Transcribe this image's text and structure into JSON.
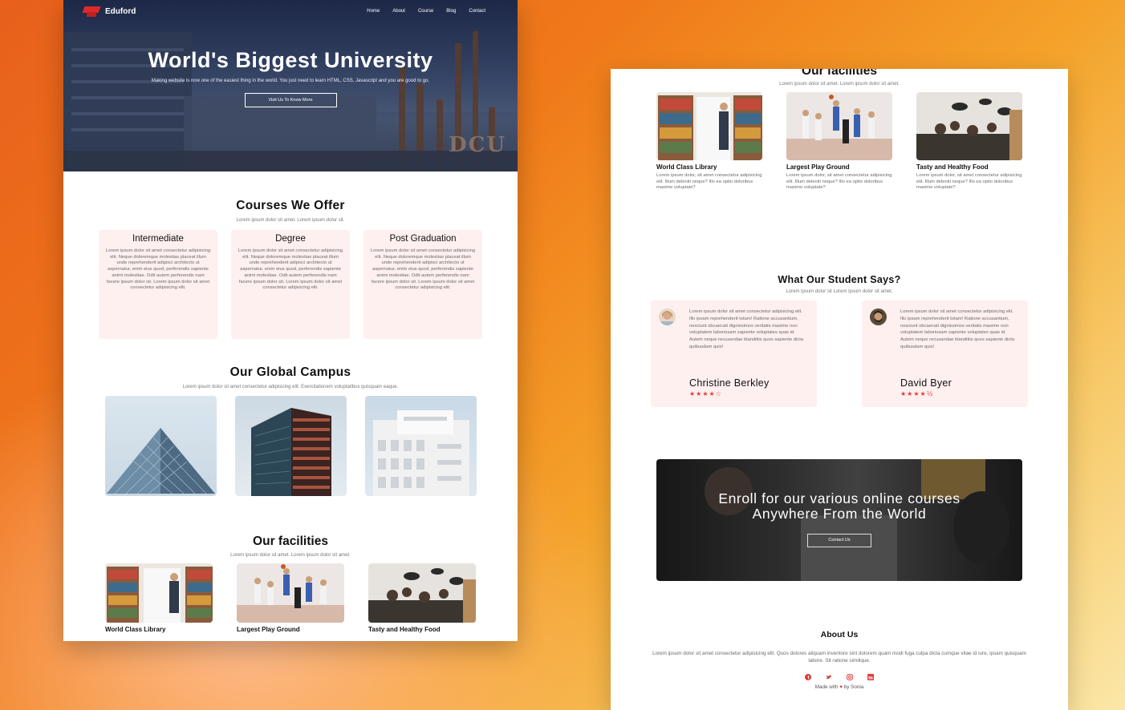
{
  "brand": {
    "name": "Eduford",
    "accent": "#e23b3b",
    "card_bg": "#fdf0ef"
  },
  "nav": {
    "items": [
      "Home",
      "About",
      "Course",
      "Blog",
      "Contact"
    ]
  },
  "hero": {
    "title": "World's Biggest University",
    "subtitle": "Making website is now one of the easiest thing in the world. You just need to learn HTML, CSS, Javascript and you are good to go.",
    "button": "Visit Us To Know More",
    "watermark": "DCU"
  },
  "courses": {
    "title": "Courses We Offer",
    "subtitle": "Lorem ipsum dolor sit amet. Lorem ipsum dolor sit.",
    "items": [
      {
        "name": "Intermediate",
        "text": "Lorem ipsum dolor sit amet consectetur adipisicing elit. Neque doloremque molestias placeat illum unde reprehenderit adipisci architecto ut aspernatur, enim eius quod, perferendis sapiente animi molestiae. Odit autem perferendis nam facere ipsum dolor sit. Lorem ipsum dolor sit amet consectetur adipisicing elit."
      },
      {
        "name": "Degree",
        "text": "Lorem ipsum dolor sit amet consectetur adipisicing elit. Neque doloremque molestias placeat illum unde reprehenderit adipisci architecto ut aspernatur, enim eius quod, perferendis sapiente animi molestiae. Odit autem perferendis nam facere ipsum dolor sit. Lorem ipsum dolor sit amet consectetur adipisicing elit."
      },
      {
        "name": "Post Graduation",
        "text": "Lorem ipsum dolor sit amet consectetur adipisicing elit. Neque doloremque molestias placeat illum unde reprehenderit adipisci architecto ut aspernatur, enim eius quod, perferendis sapiente animi molestiae. Odit autem perferendis nam facere ipsum dolor sit. Lorem ipsum dolor sit amet consectetur adipisicing elit."
      }
    ]
  },
  "campus": {
    "title": "Our Global Campus",
    "subtitle": "Lorem ipsum dolor sit amet consectetur adipisicing elit. Exercitationem voluptatibus quisquam eaque."
  },
  "facilities": {
    "title": "Our facilities",
    "subtitle": "Lorem ipsum dolor sit amet. Lorem ipsum dolor sit amet.",
    "items": [
      {
        "name": "World Class Library",
        "text": "Lorem ipsum dolor, sit amet consectetur adipisicing elit. Illum deleniti neque? Illo ea optio doloribus maxime voluptate?"
      },
      {
        "name": "Largest Play Ground",
        "text": "Lorem ipsum dolor, sit amet consectetur adipisicing elit. Illum deleniti neque? Illo ea optio doloribus maxime voluptate?"
      },
      {
        "name": "Tasty and Healthy Food",
        "text": "Lorem ipsum dolor, sit amet consectetur adipisicing elit. Illum deleniti neque? Illo ea optio doloribus maxime voluptate?"
      }
    ]
  },
  "testimonials": {
    "title": "What Our Student Says?",
    "subtitle": "Lorem ipsum dolor sit Lorem ipsum dolor sit amet.",
    "items": [
      {
        "name": "Christine Berkley",
        "rating": 3.5,
        "stars": "★★★★☆",
        "text": "Lorem ipsum dolor sit amet consectetur adipisicing elit. Illo ipsam reprehenderit totam! Ratione accusantium, nesciunt obcaecati dignissimos veritatis maxime non voluptatem laboriosam sapiente voluptates quas id. Autem neque recusandae blanditiis quos sapiente dicta quibusdam quis!"
      },
      {
        "name": "David Byer",
        "rating": 4.5,
        "stars": "★★★★½",
        "text": "Lorem ipsum dolor sit amet consectetur adipisicing elit. Illo ipsam reprehenderit totam! Ratione accusantium, nesciunt obcaecati dignissimos veritatis maxime non voluptatem laboriosam sapiente voluptates quas id. Autem neque recusandae blanditiis quos sapiente dicta quibusdam quis!"
      }
    ]
  },
  "enroll": {
    "title_line1": "Enroll for our various online courses",
    "title_line2": "Anywhere From the World",
    "button": "Contact Us"
  },
  "about": {
    "title": "About Us",
    "text": "Lorem ipsum dolor sit amet consectetur adipisicing elit. Quos dolores aliquam inventore sint dolorem quam modi fuga culpa dicta cumque vitae id iure, ipsam quisquam labore. Sit ratione similique.",
    "socials": [
      "facebook-icon",
      "twitter-icon",
      "instagram-icon",
      "linkedin-icon"
    ],
    "made_prefix": "Made with",
    "made_suffix": "by Sonia"
  }
}
